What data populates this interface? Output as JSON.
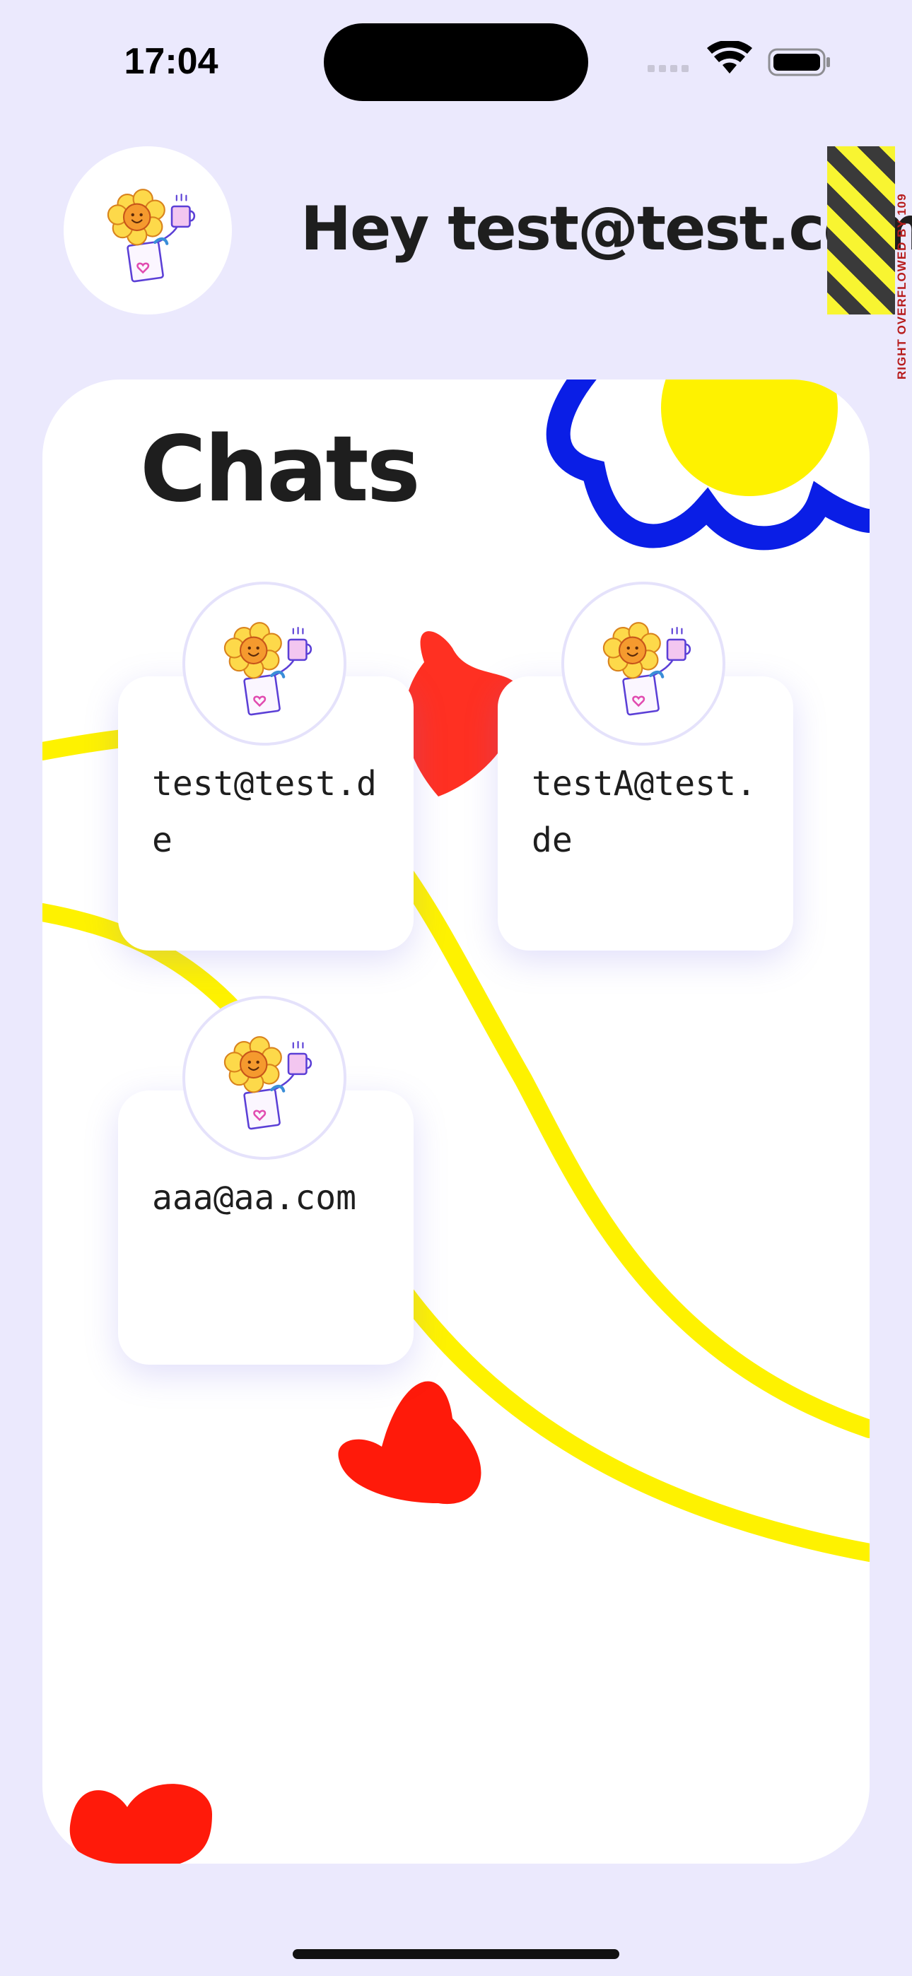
{
  "status_bar": {
    "time": "17:04"
  },
  "header": {
    "greeting": "Hey test@test.com",
    "overflow_warning": "RIGHT OVERFLOWED BY 109"
  },
  "panel": {
    "title": "Chats"
  },
  "chats": [
    {
      "name": "test@test.de"
    },
    {
      "name": "testA@test.de"
    },
    {
      "name": "aaa@aa.com"
    }
  ],
  "icons": {
    "avatar": "flower-avatar-icon",
    "wifi": "wifi-icon",
    "battery": "battery-icon",
    "signal": "cellular-signal-icon"
  },
  "colors": {
    "background": "#ebe9fd",
    "panel": "#ffffff",
    "accent_yellow": "#fef200",
    "accent_blue": "#0a1ee6",
    "accent_red": "#ff1a0a"
  }
}
